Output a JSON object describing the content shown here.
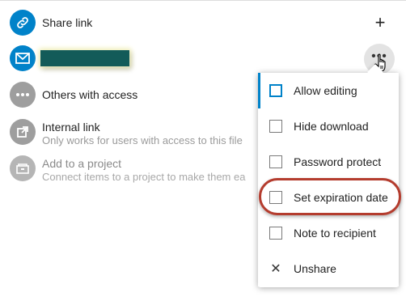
{
  "share_link": {
    "title": "Share link",
    "add_symbol": "+"
  },
  "email_share": {
    "more_symbol": "•••"
  },
  "others_access": {
    "title": "Others with access"
  },
  "internal_link": {
    "title": "Internal link",
    "subtitle": "Only works for users with access to this file"
  },
  "project": {
    "title": "Add to a project",
    "subtitle": "Connect items to a project to make them ea"
  },
  "menu": {
    "items": [
      {
        "label": "Allow editing",
        "checked": false
      },
      {
        "label": "Hide download",
        "checked": false
      },
      {
        "label": "Password protect",
        "checked": false
      },
      {
        "label": "Set expiration date",
        "checked": false
      },
      {
        "label": "Note to recipient",
        "checked": false
      },
      {
        "label": "Unshare",
        "icon": "close-icon"
      }
    ]
  },
  "colors": {
    "accent": "#0082c9",
    "redaction": "#135b59",
    "highlight_ring": "#b43c2e"
  }
}
